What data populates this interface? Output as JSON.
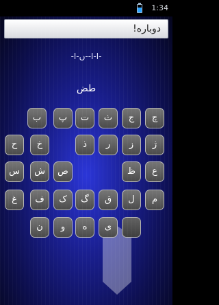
{
  "status": {
    "time": "1:34",
    "battery_level": 0.6
  },
  "title": "دوباره!",
  "hint": "-ا-ا--ں-ا-",
  "guessed_letters": "طض",
  "keyboard": {
    "row1": [
      "چ",
      "ج",
      "ث",
      "ت",
      "پ",
      "ب"
    ],
    "row2": [
      "ژ",
      "ز",
      "ر",
      "ذ",
      "",
      "خ",
      "ح"
    ],
    "row3": [
      "ع",
      "ظ",
      "",
      "ص",
      "ش",
      "س"
    ],
    "row4": [
      "م",
      "ل",
      "ق",
      "گ",
      "ک",
      "ف",
      "غ"
    ],
    "row5": [
      "",
      "ی",
      "ه",
      "و",
      "ن"
    ]
  }
}
